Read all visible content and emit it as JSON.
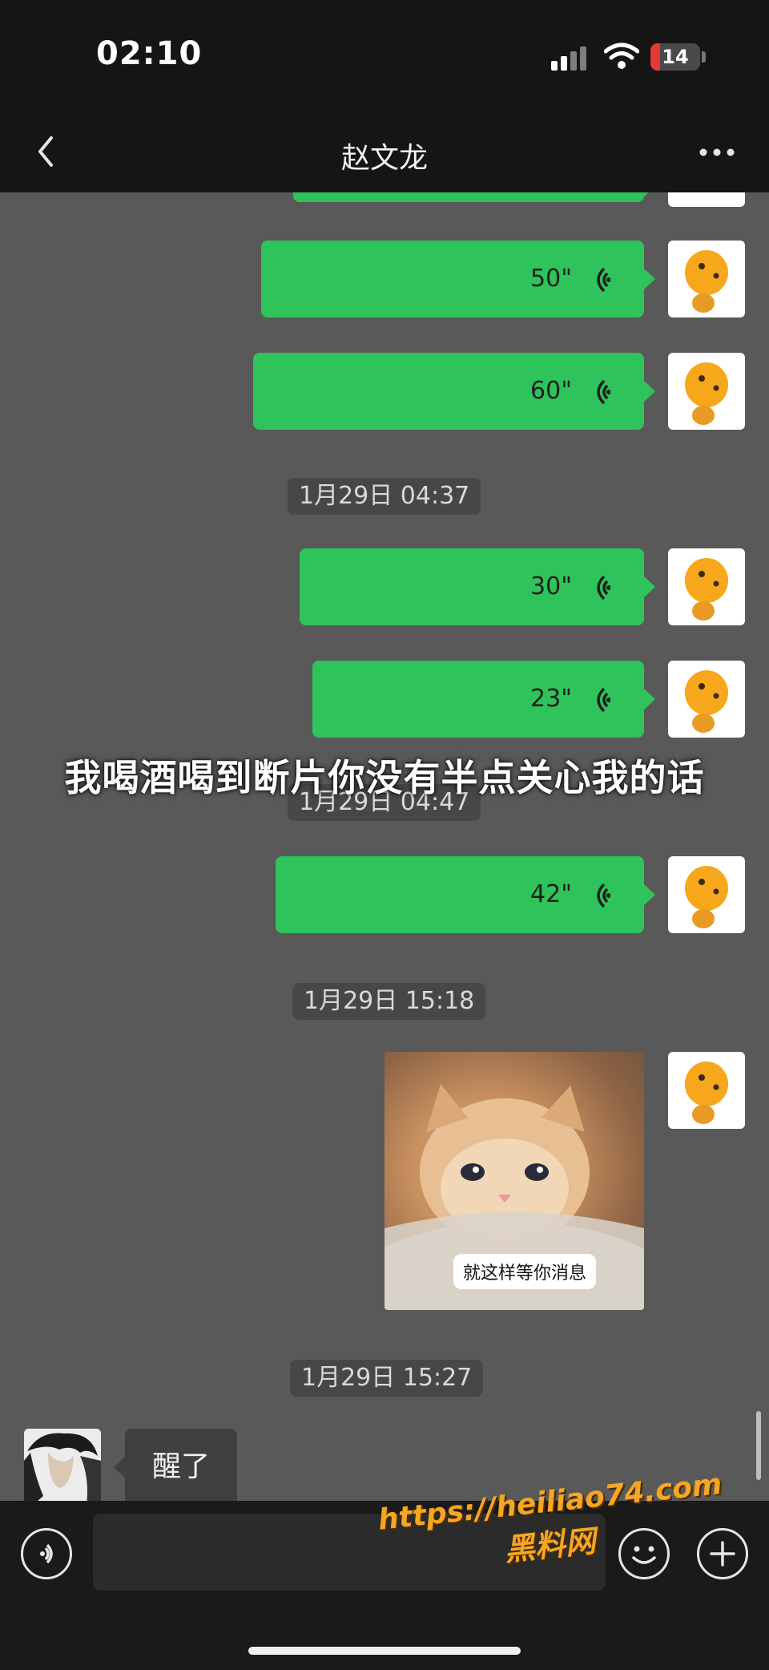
{
  "status_bar": {
    "time": "02:10",
    "battery": "14"
  },
  "header": {
    "title": "赵文龙"
  },
  "messages": [
    {
      "type": "voice",
      "duration": "50\""
    },
    {
      "type": "voice",
      "duration": "60\""
    },
    {
      "type": "timestamp",
      "text": "1月29日 04:37"
    },
    {
      "type": "voice",
      "duration": "30\""
    },
    {
      "type": "voice",
      "duration": "23\""
    },
    {
      "type": "timestamp",
      "text": "1月29日 04:47"
    },
    {
      "type": "voice",
      "duration": "42\""
    },
    {
      "type": "timestamp",
      "text": "1月29日 15:18"
    },
    {
      "type": "sticker",
      "caption": "就这样等你消息"
    },
    {
      "type": "timestamp",
      "text": "1月29日 15:27"
    },
    {
      "type": "text",
      "text": "醒了"
    }
  ],
  "overlay_caption": "我喝酒喝到断片你没有半点关心我的话",
  "watermark": {
    "url": "https://heiliao74.com",
    "name": "黑料网"
  },
  "colors": {
    "outgoing_bubble": "#2fc35b",
    "incoming_bubble": "#3f3f3f",
    "chat_background": "#595959",
    "bar_background": "#151515"
  },
  "icons": [
    "back-icon",
    "more-icon",
    "voice-wave-icon",
    "voice-mode-icon",
    "emoji-icon",
    "plus-icon"
  ]
}
